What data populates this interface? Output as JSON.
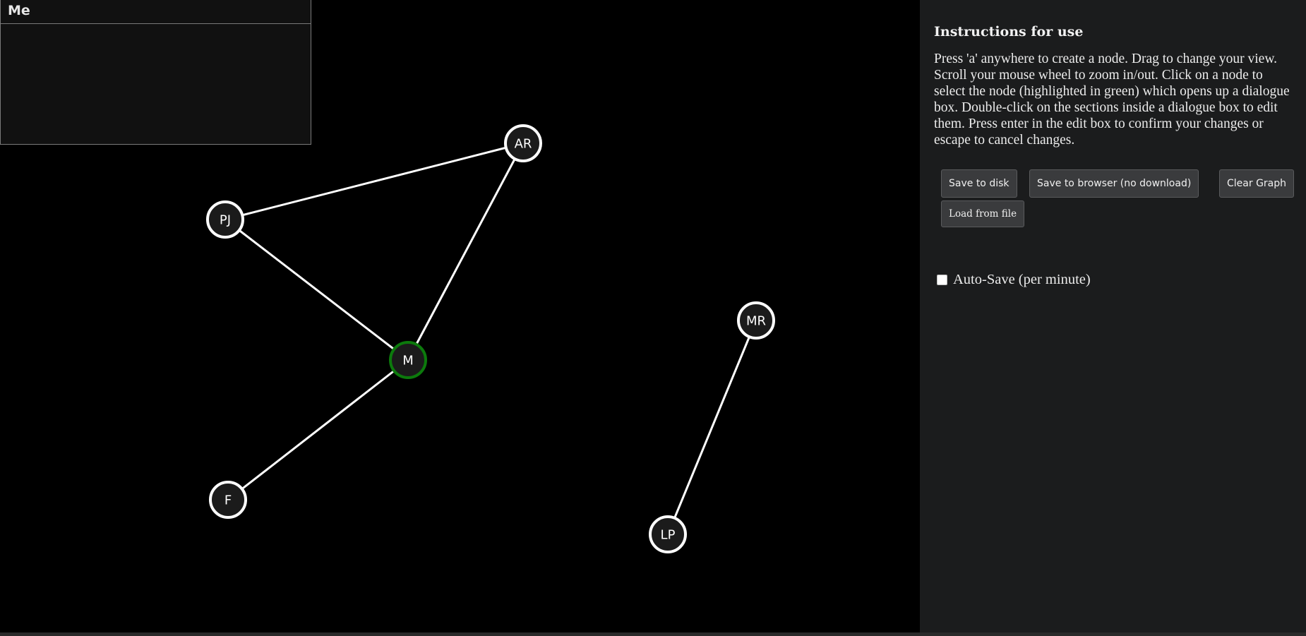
{
  "dialog": {
    "title": "Me"
  },
  "graph": {
    "nodes": [
      {
        "id": "AR",
        "label": "AR",
        "selected": false
      },
      {
        "id": "PJ",
        "label": "PJ",
        "selected": false
      },
      {
        "id": "M",
        "label": "M",
        "selected": true
      },
      {
        "id": "F",
        "label": "F",
        "selected": false
      },
      {
        "id": "MR",
        "label": "MR",
        "selected": false
      },
      {
        "id": "LP",
        "label": "LP",
        "selected": false
      }
    ],
    "edges": [
      [
        "PJ",
        "AR"
      ],
      [
        "AR",
        "M"
      ],
      [
        "PJ",
        "M"
      ],
      [
        "M",
        "F"
      ],
      [
        "MR",
        "LP"
      ]
    ],
    "colors": {
      "node_fill": "#1b1b1b",
      "node_stroke": "#ffffff",
      "selected_stroke": "#0c7a0c",
      "edge": "#ffffff"
    }
  },
  "sidebar": {
    "heading": "Instructions for use",
    "instructions": "Press 'a' anywhere to create a node. Drag to change your view. Scroll your mouse wheel to zoom in/out. Click on a node to select the node (highlighted in green) which opens up a dialogue box. Double-click on the sections inside a dialogue box to edit them. Press enter in the edit box to confirm your changes or escape to cancel changes.",
    "buttons": {
      "save_disk": "Save to disk",
      "save_browser": "Save to browser (no download)",
      "clear_graph": "Clear Graph",
      "load_file": "Load from file"
    },
    "autosave_label": "Auto-Save (per minute)",
    "autosave_checked": false
  }
}
